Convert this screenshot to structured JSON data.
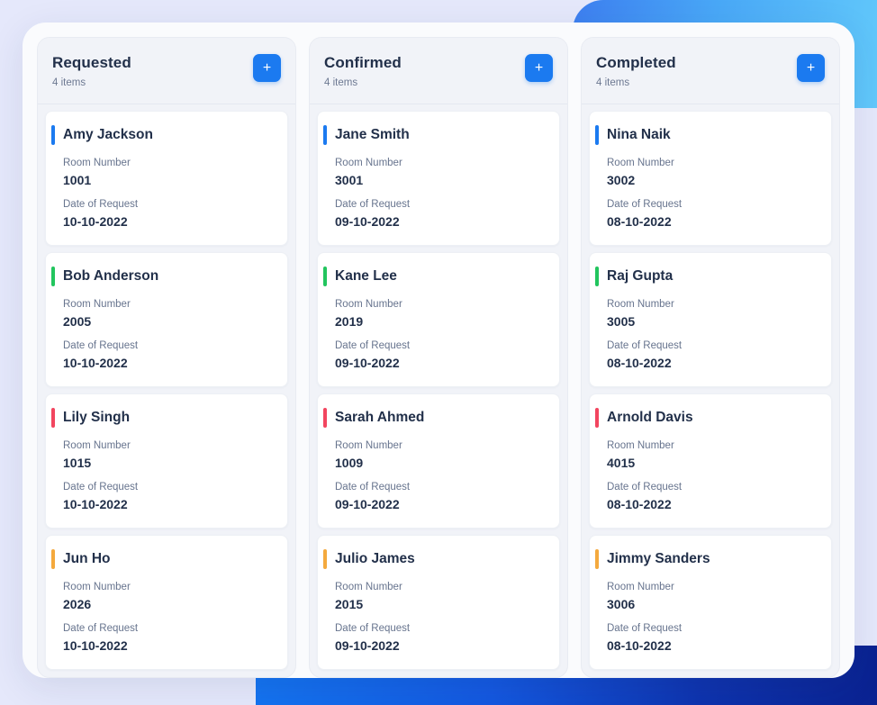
{
  "theme": {
    "page_background": "#e5e8fb",
    "panel_background": "#fafbfd",
    "column_background": "#f1f3f8",
    "card_background": "#ffffff",
    "accent_blue": "#1b7af0",
    "text_primary": "#22304a",
    "text_secondary": "#67748e",
    "blob_top_right": "#49a8f7",
    "blob_bottom": "#0e33ae"
  },
  "labels": {
    "room_number": "Room Number",
    "date_of_request": "Date of Request",
    "add_icon": "plus-icon"
  },
  "columns": [
    {
      "title": "Requested",
      "count": "4 items",
      "add_label": "+",
      "cards": [
        {
          "name": "Amy Jackson",
          "room_label": "Room Number",
          "room": "1001",
          "date_label": "Date of Request",
          "date": "10-10-2022",
          "accent": "#1b7af0"
        },
        {
          "name": "Bob Anderson",
          "room_label": "Room Number",
          "room": "2005",
          "date_label": "Date of Request",
          "date": "10-10-2022",
          "accent": "#22c55e"
        },
        {
          "name": "Lily Singh",
          "room_label": "Room Number",
          "room": "1015",
          "date_label": "Date of Request",
          "date": "10-10-2022",
          "accent": "#f2455f"
        },
        {
          "name": "Jun Ho",
          "room_label": "Room Number",
          "room": "2026",
          "date_label": "Date of Request",
          "date": "10-10-2022",
          "accent": "#f4a93d"
        }
      ]
    },
    {
      "title": "Confirmed",
      "count": "4 items",
      "add_label": "+",
      "cards": [
        {
          "name": "Jane Smith",
          "room_label": "Room Number",
          "room": "3001",
          "date_label": "Date of Request",
          "date": "09-10-2022",
          "accent": "#1b7af0"
        },
        {
          "name": "Kane Lee",
          "room_label": "Room Number",
          "room": "2019",
          "date_label": "Date of Request",
          "date": "09-10-2022",
          "accent": "#22c55e"
        },
        {
          "name": "Sarah Ahmed",
          "room_label": "Room Number",
          "room": "1009",
          "date_label": "Date of Request",
          "date": "09-10-2022",
          "accent": "#f2455f"
        },
        {
          "name": "Julio James",
          "room_label": "Room Number",
          "room": "2015",
          "date_label": "Date of Request",
          "date": "09-10-2022",
          "accent": "#f4a93d"
        }
      ]
    },
    {
      "title": "Completed",
      "count": "4 items",
      "add_label": "+",
      "cards": [
        {
          "name": "Nina Naik",
          "room_label": "Room Number",
          "room": "3002",
          "date_label": "Date of Request",
          "date": "08-10-2022",
          "accent": "#1b7af0"
        },
        {
          "name": "Raj Gupta",
          "room_label": "Room Number",
          "room": "3005",
          "date_label": "Date of Request",
          "date": "08-10-2022",
          "accent": "#22c55e"
        },
        {
          "name": "Arnold Davis",
          "room_label": "Room Number",
          "room": "4015",
          "date_label": "Date of Request",
          "date": "08-10-2022",
          "accent": "#f2455f"
        },
        {
          "name": "Jimmy Sanders",
          "room_label": "Room Number",
          "room": "3006",
          "date_label": "Date of Request",
          "date": "08-10-2022",
          "accent": "#f4a93d"
        }
      ]
    }
  ]
}
